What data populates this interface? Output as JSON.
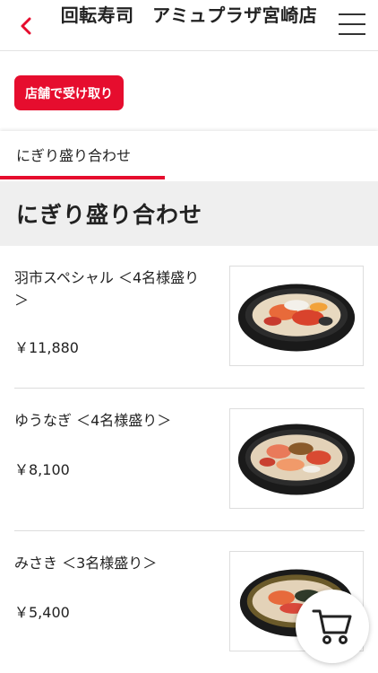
{
  "header": {
    "title": "回転寿司　アミュプラザ宮崎店",
    "back_icon": "chevron-left-icon",
    "menu_icon": "hamburger-menu-icon"
  },
  "pickup_button": {
    "label": "店舗で受け取り"
  },
  "tabs": [
    {
      "label": "にぎり盛り合わせ",
      "active": true
    }
  ],
  "section": {
    "title": "にぎり盛り合わせ"
  },
  "items": [
    {
      "name": "羽市スペシャル ＜4名様盛り＞",
      "price": "￥11,880"
    },
    {
      "name": "ゆうなぎ ＜4名様盛り＞",
      "price": "￥8,100"
    },
    {
      "name": "みさき ＜3名様盛り＞",
      "price": "￥5,400"
    }
  ],
  "cart": {
    "icon": "shopping-cart-icon"
  },
  "colors": {
    "accent": "#e60d2e",
    "section_bg": "#efefef"
  }
}
